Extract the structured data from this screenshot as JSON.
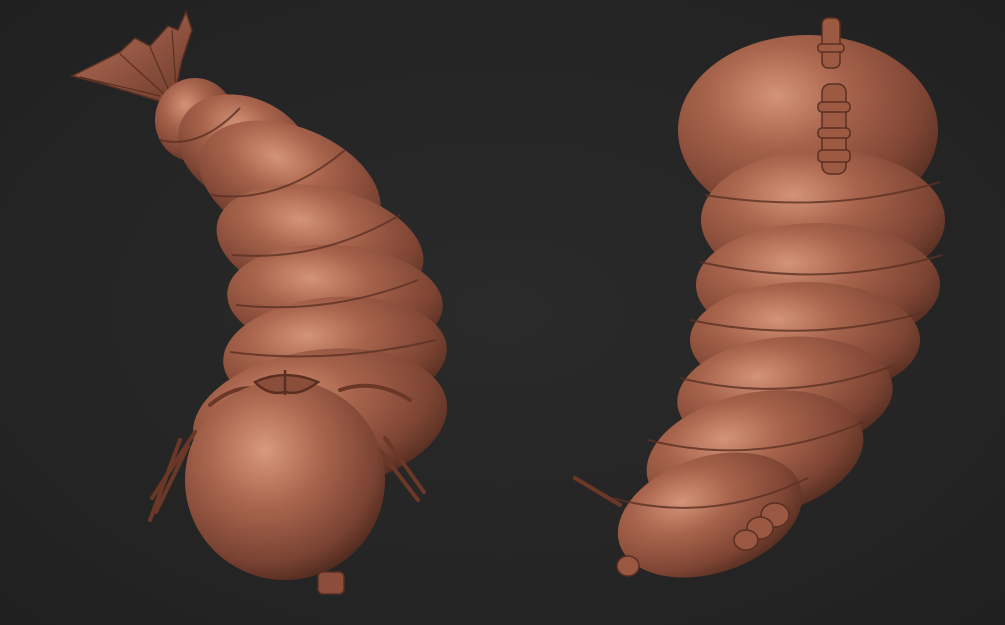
{
  "viewport": {
    "background_color": "#252525",
    "clay_color": "#9a5a45",
    "clay_highlight": "#c98a70",
    "clay_shadow": "#4e2a1f"
  },
  "models": [
    {
      "name": "larva-model-front-view",
      "view": "front"
    },
    {
      "name": "larva-model-back-view",
      "view": "back"
    }
  ]
}
